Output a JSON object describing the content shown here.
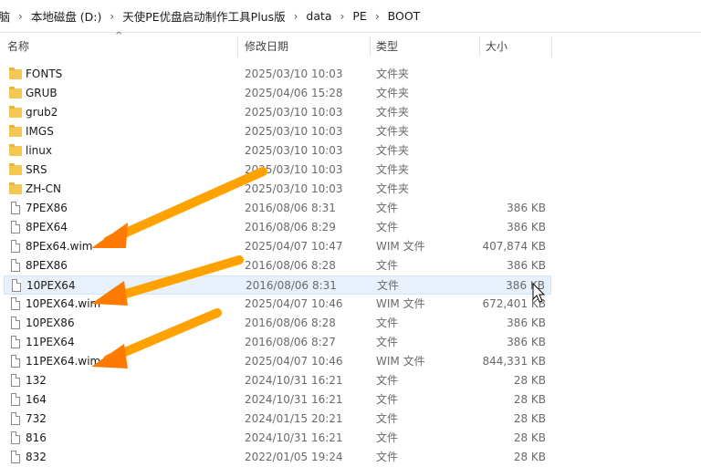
{
  "address": {
    "crumbs": [
      "电脑",
      "本地磁盘 (D:)",
      "天使PE优盘启动制作工具Plus版",
      "data",
      "PE",
      "BOOT"
    ],
    "separator": "›"
  },
  "columns": {
    "name": "名称",
    "date": "修改日期",
    "type": "类型",
    "size": "大小"
  },
  "sort_indicator": "^",
  "files": [
    {
      "name": "FONTS",
      "date": "2025/03/10 10:03",
      "type": "文件夹",
      "size": "",
      "kind": "folder"
    },
    {
      "name": "GRUB",
      "date": "2025/04/06 15:28",
      "type": "文件夹",
      "size": "",
      "kind": "folder"
    },
    {
      "name": "grub2",
      "date": "2025/03/10 10:03",
      "type": "文件夹",
      "size": "",
      "kind": "folder"
    },
    {
      "name": "IMGS",
      "date": "2025/03/10 10:03",
      "type": "文件夹",
      "size": "",
      "kind": "folder"
    },
    {
      "name": "linux",
      "date": "2025/03/10 10:03",
      "type": "文件夹",
      "size": "",
      "kind": "folder"
    },
    {
      "name": "SRS",
      "date": "2025/03/10 10:03",
      "type": "文件夹",
      "size": "",
      "kind": "folder"
    },
    {
      "name": "ZH-CN",
      "date": "2025/03/10 10:03",
      "type": "文件夹",
      "size": "",
      "kind": "folder"
    },
    {
      "name": "7PEX86",
      "date": "2016/08/06 8:31",
      "type": "文件",
      "size": "386 KB",
      "kind": "file"
    },
    {
      "name": "8PEX64",
      "date": "2016/08/06 8:29",
      "type": "文件",
      "size": "386 KB",
      "kind": "file"
    },
    {
      "name": "8PEx64.wim",
      "date": "2025/04/07 10:47",
      "type": "WIM 文件",
      "size": "407,874 KB",
      "kind": "file"
    },
    {
      "name": "8PEX86",
      "date": "2016/08/06 8:28",
      "type": "文件",
      "size": "386 KB",
      "kind": "file"
    },
    {
      "name": "10PEX64",
      "date": "2016/08/06 8:31",
      "type": "文件",
      "size": "386 KB",
      "kind": "file",
      "hover": true
    },
    {
      "name": "10PEX64.wim",
      "date": "2025/04/07 10:46",
      "type": "WIM 文件",
      "size": "672,401 KB",
      "kind": "file"
    },
    {
      "name": "10PEX86",
      "date": "2016/08/06 8:28",
      "type": "文件",
      "size": "386 KB",
      "kind": "file"
    },
    {
      "name": "11PEX64",
      "date": "2016/08/06 8:27",
      "type": "文件",
      "size": "386 KB",
      "kind": "file"
    },
    {
      "name": "11PEX64.wim",
      "date": "2025/04/07 10:46",
      "type": "WIM 文件",
      "size": "844,331 KB",
      "kind": "file"
    },
    {
      "name": "132",
      "date": "2024/10/31 16:21",
      "type": "文件",
      "size": "28 KB",
      "kind": "file"
    },
    {
      "name": "164",
      "date": "2024/10/31 16:21",
      "type": "文件",
      "size": "28 KB",
      "kind": "file"
    },
    {
      "name": "732",
      "date": "2024/01/15 20:21",
      "type": "文件",
      "size": "28 KB",
      "kind": "file"
    },
    {
      "name": "816",
      "date": "2024/10/31 16:21",
      "type": "文件",
      "size": "28 KB",
      "kind": "file"
    },
    {
      "name": "832",
      "date": "2022/01/05 19:24",
      "type": "文件",
      "size": "28 KB",
      "kind": "file"
    }
  ],
  "annotation_color": "#ff8a00"
}
